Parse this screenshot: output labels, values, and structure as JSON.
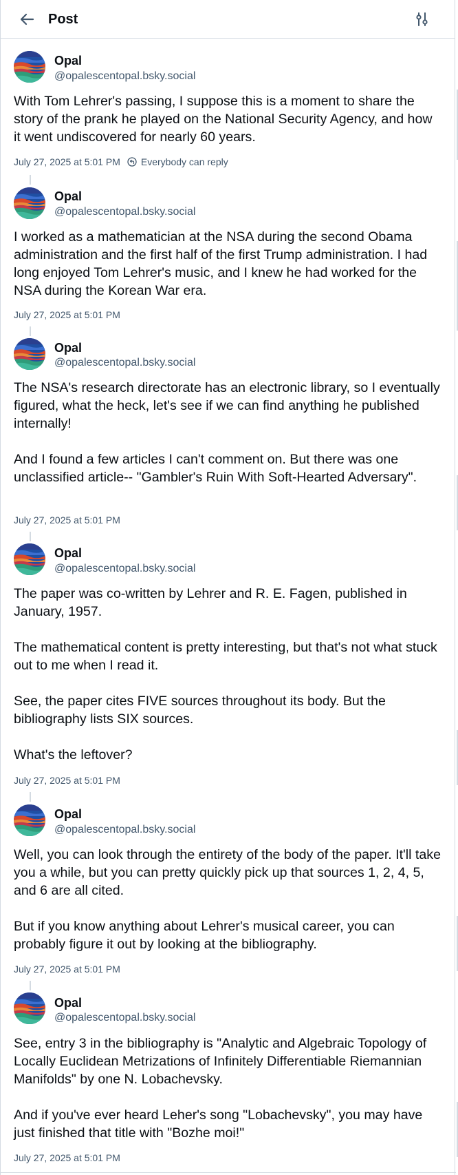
{
  "header": {
    "title": "Post",
    "back_icon": "arrow-left-icon",
    "settings_icon": "sliders-icon"
  },
  "author": {
    "name": "Opal",
    "handle": "@opalescentopal.bsky.social"
  },
  "colors": {
    "text": "#0b0f14",
    "muted": "#42576c",
    "border": "#d4dbe2"
  },
  "posts": [
    {
      "text": "With Tom Lehrer's passing, I suppose this is a moment to share the story of the prank he played on the National Security Agency, and how it went undiscovered for nearly 60 years.",
      "timestamp": "July 27, 2025 at 5:01 PM",
      "reply_setting": "Everybody can reply"
    },
    {
      "text": "I worked as a mathematician at the NSA during the second Obama administration and the first half of the first Trump administration. I had long enjoyed Tom Lehrer's music, and I knew he had worked for the NSA during the Korean War era.",
      "timestamp": "July 27, 2025 at 5:01 PM"
    },
    {
      "text": "The NSA's research directorate has an electronic library, so I eventually figured, what the heck, let's see if we can find anything he published internally!\n\nAnd I found a few articles I can't comment on. But there was one unclassified article-- \"Gambler's Ruin With Soft-Hearted Adversary\".",
      "timestamp": "July 27, 2025 at 5:01 PM"
    },
    {
      "text": "The paper was co-written by Lehrer and R. E. Fagen, published in January, 1957.\n\nThe mathematical content is pretty interesting, but that's not what stuck out to me when I read it.\n\nSee, the paper cites FIVE sources throughout its body. But the bibliography lists SIX sources.\n\nWhat's the leftover?",
      "timestamp": "July 27, 2025 at 5:01 PM"
    },
    {
      "text": "Well, you can look through the entirety of the body of the paper. It'll take you a while, but you can pretty quickly pick up that sources 1, 2, 4, 5, and 6 are all cited.\n\nBut if you know anything about Lehrer's musical career, you can probably figure it out by looking at the bibliography.",
      "timestamp": "July 27, 2025 at 5:01 PM"
    },
    {
      "text": "See, entry 3 in the bibliography is \"Analytic and Algebraic Topology of Locally Euclidean Metrizations of Infinitely Differentiable Riemannian Manifolds\" by one N. Lobachevsky.\n\nAnd if you've ever heard Leher's song \"Lobachevsky\", you may have just finished that title with \"Bozhe moi!\"",
      "timestamp": "July 27, 2025 at 5:01 PM"
    }
  ]
}
